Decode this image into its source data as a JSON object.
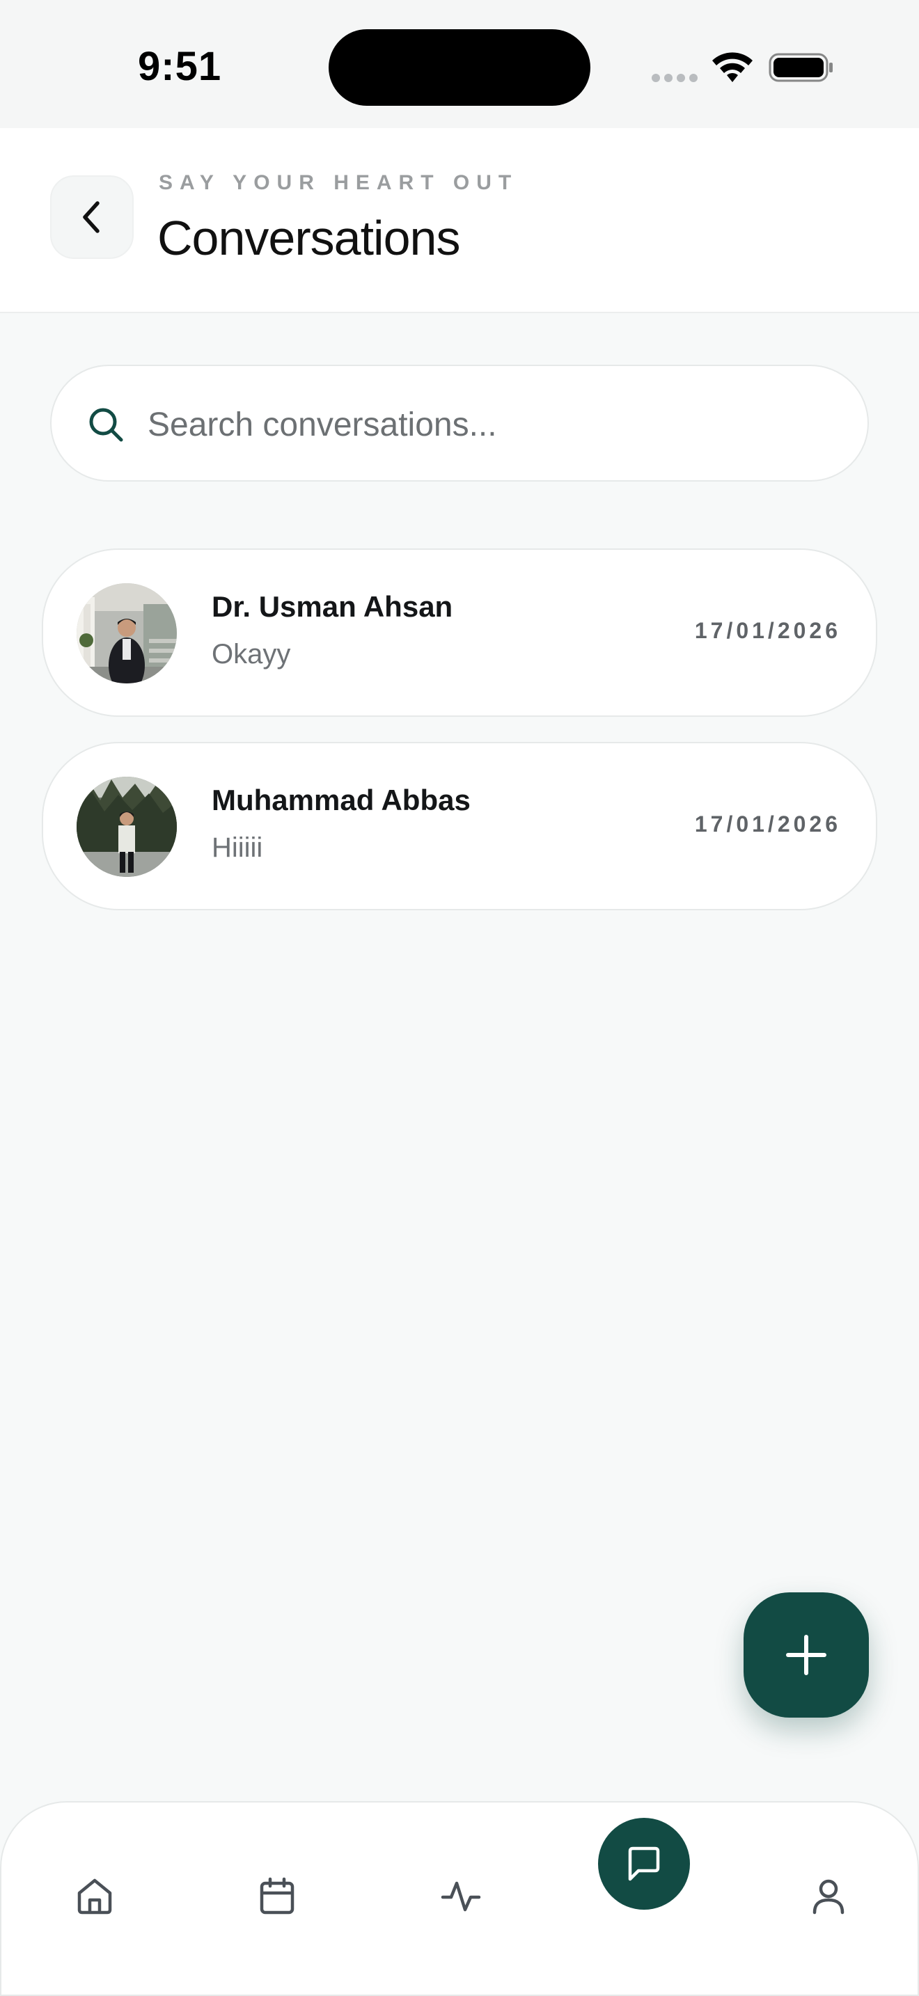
{
  "status_bar": {
    "time": "9:51"
  },
  "header": {
    "eyebrow": "SAY YOUR HEART OUT",
    "title": "Conversations",
    "back_icon": "chevron-left-icon"
  },
  "search": {
    "placeholder": "Search conversations...",
    "value": "",
    "icon": "search-icon"
  },
  "conversations": [
    {
      "name": "Dr. Usman Ahsan",
      "preview": "Okayy",
      "date": "17/01/2026"
    },
    {
      "name": "Muhammad Abbas",
      "preview": "Hiiiii",
      "date": "17/01/2026"
    }
  ],
  "fab": {
    "icon": "plus-icon"
  },
  "bottom_nav": {
    "items": [
      {
        "icon": "home-icon",
        "active": false
      },
      {
        "icon": "calendar-icon",
        "active": false
      },
      {
        "icon": "activity-icon",
        "active": false
      },
      {
        "icon": "chat-icon",
        "active": true
      },
      {
        "icon": "profile-icon",
        "active": false
      }
    ]
  },
  "colors": {
    "accent": "#124b44",
    "background": "#f7f9f9",
    "card": "#ffffff",
    "muted_text": "#6e7276"
  }
}
